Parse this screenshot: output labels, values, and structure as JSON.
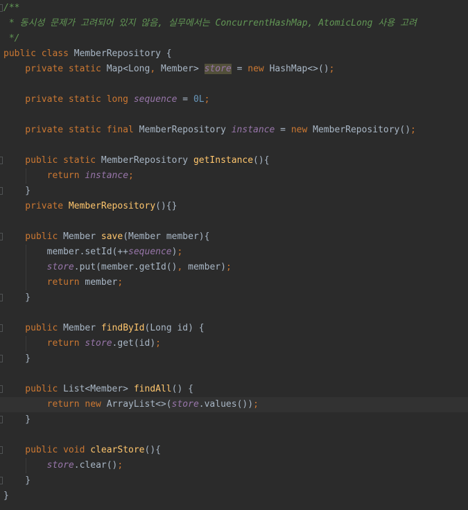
{
  "lines": [
    {
      "id": "L1",
      "tokens": [
        {
          "t": "/**",
          "c": "cmt"
        }
      ]
    },
    {
      "id": "L2",
      "tokens": [
        {
          "t": " * 동시성 문제가 고려되어 있지 않음, 실무에서는 ConcurrentHashMap, AtomicLong 사용 고려",
          "c": "cmt"
        }
      ]
    },
    {
      "id": "L3",
      "tokens": [
        {
          "t": " */",
          "c": "cmt"
        }
      ]
    },
    {
      "id": "L4",
      "tokens": [
        {
          "t": "public class ",
          "c": "kw"
        },
        {
          "t": "MemberRepository {",
          "c": "txt"
        }
      ]
    },
    {
      "id": "L5",
      "tokens": [
        {
          "t": "    private static ",
          "c": "kw"
        },
        {
          "t": "Map<Long",
          "c": "txt"
        },
        {
          "t": ", ",
          "c": "kw"
        },
        {
          "t": "Member> ",
          "c": "txt"
        },
        {
          "t": "store",
          "c": "fld hl"
        },
        {
          "t": " = ",
          "c": "txt"
        },
        {
          "t": "new ",
          "c": "kw"
        },
        {
          "t": "HashMap<>()",
          "c": "txt"
        },
        {
          "t": ";",
          "c": "kw"
        }
      ]
    },
    {
      "id": "L6",
      "tokens": []
    },
    {
      "id": "L7",
      "tokens": [
        {
          "t": "    private static long ",
          "c": "kw"
        },
        {
          "t": "sequence",
          "c": "fld"
        },
        {
          "t": " = ",
          "c": "txt"
        },
        {
          "t": "0L",
          "c": "num"
        },
        {
          "t": ";",
          "c": "kw"
        }
      ]
    },
    {
      "id": "L8",
      "tokens": []
    },
    {
      "id": "L9",
      "tokens": [
        {
          "t": "    private static final ",
          "c": "kw"
        },
        {
          "t": "MemberRepository ",
          "c": "txt"
        },
        {
          "t": "instance",
          "c": "fld"
        },
        {
          "t": " = ",
          "c": "txt"
        },
        {
          "t": "new ",
          "c": "kw"
        },
        {
          "t": "MemberRepository()",
          "c": "txt"
        },
        {
          "t": ";",
          "c": "kw"
        }
      ]
    },
    {
      "id": "L10",
      "tokens": []
    },
    {
      "id": "L11",
      "tokens": [
        {
          "t": "    public static ",
          "c": "kw"
        },
        {
          "t": "MemberRepository ",
          "c": "txt"
        },
        {
          "t": "getInstance",
          "c": "fn"
        },
        {
          "t": "(){",
          "c": "txt"
        }
      ]
    },
    {
      "id": "L12",
      "tokens": [
        {
          "t": "        return ",
          "c": "kw"
        },
        {
          "t": "instance",
          "c": "fld"
        },
        {
          "t": ";",
          "c": "kw"
        }
      ]
    },
    {
      "id": "L13",
      "tokens": [
        {
          "t": "    }",
          "c": "txt"
        }
      ]
    },
    {
      "id": "L14",
      "tokens": [
        {
          "t": "    private ",
          "c": "kw"
        },
        {
          "t": "MemberRepository",
          "c": "fn"
        },
        {
          "t": "(){}",
          "c": "txt"
        }
      ]
    },
    {
      "id": "L15",
      "tokens": []
    },
    {
      "id": "L16",
      "tokens": [
        {
          "t": "    public ",
          "c": "kw"
        },
        {
          "t": "Member ",
          "c": "txt"
        },
        {
          "t": "save",
          "c": "fn"
        },
        {
          "t": "(Member member){",
          "c": "txt"
        }
      ]
    },
    {
      "id": "L17",
      "tokens": [
        {
          "t": "        member.setId(++",
          "c": "txt"
        },
        {
          "t": "sequence",
          "c": "fld"
        },
        {
          "t": ")",
          "c": "txt"
        },
        {
          "t": ";",
          "c": "kw"
        }
      ]
    },
    {
      "id": "L18",
      "tokens": [
        {
          "t": "        ",
          "c": "txt"
        },
        {
          "t": "store",
          "c": "fld"
        },
        {
          "t": ".put(member.getId()",
          "c": "txt"
        },
        {
          "t": ", ",
          "c": "kw"
        },
        {
          "t": "member)",
          "c": "txt"
        },
        {
          "t": ";",
          "c": "kw"
        }
      ]
    },
    {
      "id": "L19",
      "tokens": [
        {
          "t": "        return ",
          "c": "kw"
        },
        {
          "t": "member",
          "c": "txt"
        },
        {
          "t": ";",
          "c": "kw"
        }
      ]
    },
    {
      "id": "L20",
      "tokens": [
        {
          "t": "    }",
          "c": "txt"
        }
      ]
    },
    {
      "id": "L21",
      "tokens": []
    },
    {
      "id": "L22",
      "tokens": [
        {
          "t": "    public ",
          "c": "kw"
        },
        {
          "t": "Member ",
          "c": "txt"
        },
        {
          "t": "findById",
          "c": "fn"
        },
        {
          "t": "(Long id) {",
          "c": "txt"
        }
      ]
    },
    {
      "id": "L23",
      "tokens": [
        {
          "t": "        return ",
          "c": "kw"
        },
        {
          "t": "store",
          "c": "fld"
        },
        {
          "t": ".get(id)",
          "c": "txt"
        },
        {
          "t": ";",
          "c": "kw"
        }
      ]
    },
    {
      "id": "L24",
      "tokens": [
        {
          "t": "    }",
          "c": "txt"
        }
      ]
    },
    {
      "id": "L25",
      "tokens": []
    },
    {
      "id": "L26",
      "tokens": [
        {
          "t": "    public ",
          "c": "kw"
        },
        {
          "t": "List<Member> ",
          "c": "txt"
        },
        {
          "t": "findAll",
          "c": "fn"
        },
        {
          "t": "() {",
          "c": "txt"
        }
      ]
    },
    {
      "id": "L27",
      "tokens": [
        {
          "t": "        return new ",
          "c": "kw"
        },
        {
          "t": "ArrayList<>(",
          "c": "txt"
        },
        {
          "t": "store",
          "c": "fld"
        },
        {
          "t": ".values())",
          "c": "txt"
        },
        {
          "t": ";",
          "c": "kw"
        }
      ]
    },
    {
      "id": "L28",
      "tokens": [
        {
          "t": "    }",
          "c": "txt"
        }
      ]
    },
    {
      "id": "L29",
      "tokens": []
    },
    {
      "id": "L30",
      "tokens": [
        {
          "t": "    public void ",
          "c": "kw"
        },
        {
          "t": "clearStore",
          "c": "fn"
        },
        {
          "t": "(){",
          "c": "txt"
        }
      ]
    },
    {
      "id": "L31",
      "tokens": [
        {
          "t": "        ",
          "c": "txt"
        },
        {
          "t": "store",
          "c": "fld"
        },
        {
          "t": ".clear()",
          "c": "txt"
        },
        {
          "t": ";",
          "c": "kw"
        }
      ]
    },
    {
      "id": "L32",
      "tokens": [
        {
          "t": "    }",
          "c": "txt"
        }
      ]
    },
    {
      "id": "L33",
      "tokens": [
        {
          "t": "}",
          "c": "txt"
        }
      ]
    }
  ],
  "current_line": 27,
  "fold_markers": [
    1,
    11,
    13,
    16,
    20,
    22,
    24,
    26,
    28,
    30,
    32
  ],
  "colors": {
    "background": "#2b2b2b",
    "keyword": "#cc7832",
    "field": "#9876aa",
    "function": "#ffc66d",
    "number": "#6897bb",
    "comment": "#629755",
    "text": "#a9b7c6",
    "highlight": "#52503a",
    "current_line": "#323232"
  }
}
